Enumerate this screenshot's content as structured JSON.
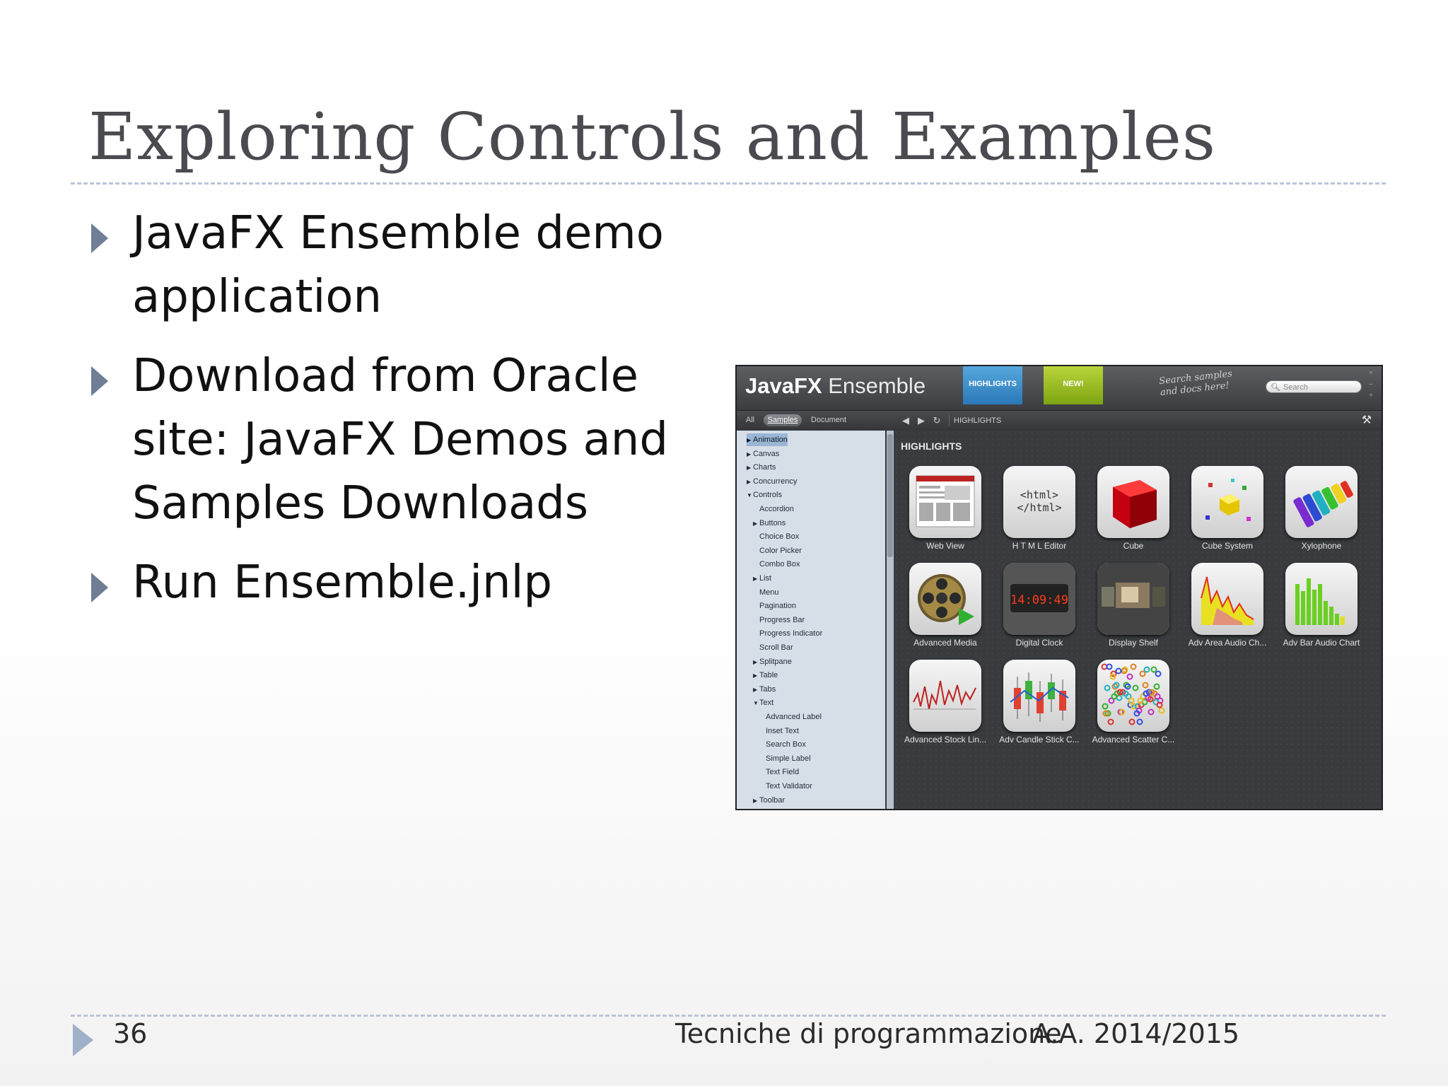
{
  "slide": {
    "title": "Exploring Controls and Examples",
    "bullets": [
      "JavaFX Ensemble demo application",
      "Download from Oracle site:  JavaFX Demos and Samples Downloads",
      "Run Ensemble.jnlp"
    ],
    "footer": {
      "page_number": "36",
      "course": "Tecniche di programmazione",
      "year": "A.A. 2014/2015"
    }
  },
  "colors": {
    "title": "#4a4a50",
    "bullet_marker": "#6f7d95",
    "rule": "#b9c4d6",
    "app_bg": "#37383b",
    "sidebar_bg": "#d6dee7",
    "ribbon_highlights": "#2a78b8",
    "ribbon_new": "#7ea412"
  },
  "app": {
    "brand_bold": "JavaFX",
    "brand_light": "Ensemble",
    "ribbons": {
      "highlights": "HIGHLIGHTS",
      "new": "NEW!"
    },
    "search_hint": "Search samples and docs here!",
    "search_placeholder": "Search",
    "search_icon": "magnifier-icon",
    "window_controls": [
      "×",
      "–",
      "+"
    ],
    "tabs": {
      "all": "All",
      "samples": "Samples",
      "document": "Document"
    },
    "nav": {
      "back_icon": "back-arrow-icon",
      "forward_icon": "forward-arrow-icon",
      "refresh_icon": "refresh-icon",
      "tools_icon": "tools-icon"
    },
    "breadcrumb": "HIGHLIGHTS",
    "section_title": "HIGHLIGHTS",
    "tree": [
      {
        "label": "Animation",
        "expander": "▶",
        "depth": 0,
        "selected": true
      },
      {
        "label": "Canvas",
        "expander": "▶",
        "depth": 0
      },
      {
        "label": "Charts",
        "expander": "▶",
        "depth": 0
      },
      {
        "label": "Concurrency",
        "expander": "▶",
        "depth": 0
      },
      {
        "label": "Controls",
        "expander": "▼",
        "depth": 0
      },
      {
        "label": "Accordion",
        "expander": "",
        "depth": 1
      },
      {
        "label": "Buttons",
        "expander": "▶",
        "depth": 1
      },
      {
        "label": "Choice Box",
        "expander": "",
        "depth": 1
      },
      {
        "label": "Color Picker",
        "expander": "",
        "depth": 1
      },
      {
        "label": "Combo Box",
        "expander": "",
        "depth": 1
      },
      {
        "label": "List",
        "expander": "▶",
        "depth": 1
      },
      {
        "label": "Menu",
        "expander": "",
        "depth": 1
      },
      {
        "label": "Pagination",
        "expander": "",
        "depth": 1
      },
      {
        "label": "Progress Bar",
        "expander": "",
        "depth": 1
      },
      {
        "label": "Progress Indicator",
        "expander": "",
        "depth": 1
      },
      {
        "label": "Scroll Bar",
        "expander": "",
        "depth": 1
      },
      {
        "label": "Splitpane",
        "expander": "▶",
        "depth": 1
      },
      {
        "label": "Table",
        "expander": "▶",
        "depth": 1
      },
      {
        "label": "Tabs",
        "expander": "▶",
        "depth": 1
      },
      {
        "label": "Text",
        "expander": "▼",
        "depth": 1
      },
      {
        "label": "Advanced Label",
        "expander": "",
        "depth": 2
      },
      {
        "label": "Inset Text",
        "expander": "",
        "depth": 2
      },
      {
        "label": "Search Box",
        "expander": "",
        "depth": 2
      },
      {
        "label": "Simple Label",
        "expander": "",
        "depth": 2
      },
      {
        "label": "Text Field",
        "expander": "",
        "depth": 2
      },
      {
        "label": "Text Validator",
        "expander": "",
        "depth": 2
      },
      {
        "label": "Toolbar",
        "expander": "▶",
        "depth": 1
      }
    ],
    "highlights": [
      {
        "label": "Web View",
        "icon": "web-view-icon"
      },
      {
        "label": "H T M L Editor",
        "icon": "html-editor-icon",
        "icon_text": "<html>\n</html>"
      },
      {
        "label": "Cube",
        "icon": "cube-icon"
      },
      {
        "label": "Cube System",
        "icon": "cube-system-icon"
      },
      {
        "label": "Xylophone",
        "icon": "xylophone-icon"
      },
      {
        "label": "Advanced Media",
        "icon": "film-reel-icon"
      },
      {
        "label": "Digital Clock",
        "icon": "digital-clock-icon",
        "icon_text": "14:09:49"
      },
      {
        "label": "Display Shelf",
        "icon": "display-shelf-icon"
      },
      {
        "label": "Adv Area Audio Ch...",
        "icon": "area-audio-chart-icon"
      },
      {
        "label": "Adv Bar Audio Chart",
        "icon": "bar-audio-chart-icon"
      },
      {
        "label": "Advanced Stock Lin...",
        "icon": "stock-line-chart-icon"
      },
      {
        "label": "Adv Candle Stick C...",
        "icon": "candlestick-chart-icon"
      },
      {
        "label": "Advanced Scatter C...",
        "icon": "scatter-chart-icon"
      }
    ]
  }
}
